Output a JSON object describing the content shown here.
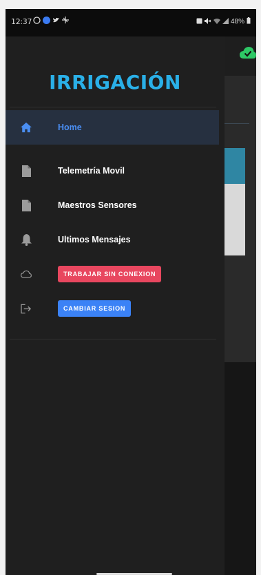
{
  "status_bar": {
    "time": "12:37",
    "battery": "48%"
  },
  "drawer": {
    "logo_text": "IRRIGACIÓN",
    "items": [
      {
        "label": "Home",
        "icon": "home-icon",
        "active": true
      },
      {
        "label": "Telemetría Movil",
        "icon": "file-icon",
        "active": false
      },
      {
        "label": "Maestros Sensores",
        "icon": "file-icon",
        "active": false
      },
      {
        "label": "Ultimos Mensajes",
        "icon": "bell-icon",
        "active": false
      }
    ],
    "offline_button": {
      "label": "TRABAJAR SIN CONEXION",
      "icon": "cloud-icon",
      "color": "#e8475f"
    },
    "session_button": {
      "label": "CAMBIAR SESION",
      "icon": "logout-icon",
      "color": "#3b82f6"
    }
  },
  "colors": {
    "accent": "#4a8ef2",
    "logo": "#2ab0e8",
    "sync_ok": "#2ec866"
  }
}
